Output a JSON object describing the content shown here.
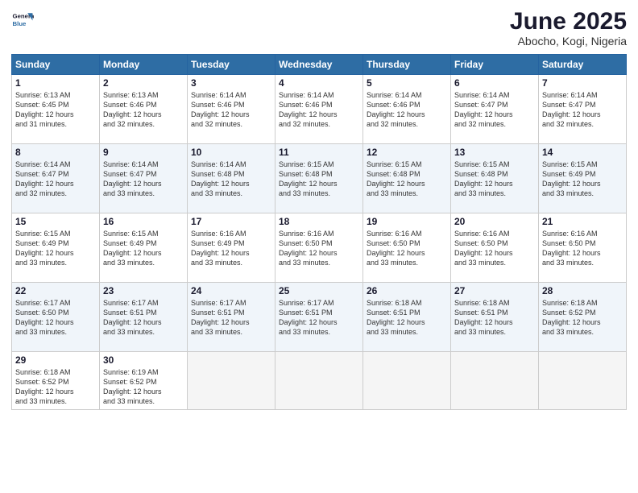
{
  "header": {
    "logo_line1": "General",
    "logo_line2": "Blue",
    "month_title": "June 2025",
    "location": "Abocho, Kogi, Nigeria"
  },
  "weekdays": [
    "Sunday",
    "Monday",
    "Tuesday",
    "Wednesday",
    "Thursday",
    "Friday",
    "Saturday"
  ],
  "weeks": [
    [
      {
        "day": "1",
        "rise": "6:13 AM",
        "set": "6:45 PM",
        "hours": "12 hours",
        "mins": "31 minutes"
      },
      {
        "day": "2",
        "rise": "6:13 AM",
        "set": "6:46 PM",
        "hours": "12 hours",
        "mins": "32 minutes"
      },
      {
        "day": "3",
        "rise": "6:14 AM",
        "set": "6:46 PM",
        "hours": "12 hours",
        "mins": "32 minutes"
      },
      {
        "day": "4",
        "rise": "6:14 AM",
        "set": "6:46 PM",
        "hours": "12 hours",
        "mins": "32 minutes"
      },
      {
        "day": "5",
        "rise": "6:14 AM",
        "set": "6:46 PM",
        "hours": "12 hours",
        "mins": "32 minutes"
      },
      {
        "day": "6",
        "rise": "6:14 AM",
        "set": "6:47 PM",
        "hours": "12 hours",
        "mins": "32 minutes"
      },
      {
        "day": "7",
        "rise": "6:14 AM",
        "set": "6:47 PM",
        "hours": "12 hours",
        "mins": "32 minutes"
      }
    ],
    [
      {
        "day": "8",
        "rise": "6:14 AM",
        "set": "6:47 PM",
        "hours": "12 hours",
        "mins": "32 minutes"
      },
      {
        "day": "9",
        "rise": "6:14 AM",
        "set": "6:47 PM",
        "hours": "12 hours",
        "mins": "33 minutes"
      },
      {
        "day": "10",
        "rise": "6:14 AM",
        "set": "6:48 PM",
        "hours": "12 hours",
        "mins": "33 minutes"
      },
      {
        "day": "11",
        "rise": "6:15 AM",
        "set": "6:48 PM",
        "hours": "12 hours",
        "mins": "33 minutes"
      },
      {
        "day": "12",
        "rise": "6:15 AM",
        "set": "6:48 PM",
        "hours": "12 hours",
        "mins": "33 minutes"
      },
      {
        "day": "13",
        "rise": "6:15 AM",
        "set": "6:48 PM",
        "hours": "12 hours",
        "mins": "33 minutes"
      },
      {
        "day": "14",
        "rise": "6:15 AM",
        "set": "6:49 PM",
        "hours": "12 hours",
        "mins": "33 minutes"
      }
    ],
    [
      {
        "day": "15",
        "rise": "6:15 AM",
        "set": "6:49 PM",
        "hours": "12 hours",
        "mins": "33 minutes"
      },
      {
        "day": "16",
        "rise": "6:15 AM",
        "set": "6:49 PM",
        "hours": "12 hours",
        "mins": "33 minutes"
      },
      {
        "day": "17",
        "rise": "6:16 AM",
        "set": "6:49 PM",
        "hours": "12 hours",
        "mins": "33 minutes"
      },
      {
        "day": "18",
        "rise": "6:16 AM",
        "set": "6:50 PM",
        "hours": "12 hours",
        "mins": "33 minutes"
      },
      {
        "day": "19",
        "rise": "6:16 AM",
        "set": "6:50 PM",
        "hours": "12 hours",
        "mins": "33 minutes"
      },
      {
        "day": "20",
        "rise": "6:16 AM",
        "set": "6:50 PM",
        "hours": "12 hours",
        "mins": "33 minutes"
      },
      {
        "day": "21",
        "rise": "6:16 AM",
        "set": "6:50 PM",
        "hours": "12 hours",
        "mins": "33 minutes"
      }
    ],
    [
      {
        "day": "22",
        "rise": "6:17 AM",
        "set": "6:50 PM",
        "hours": "12 hours",
        "mins": "33 minutes"
      },
      {
        "day": "23",
        "rise": "6:17 AM",
        "set": "6:51 PM",
        "hours": "12 hours",
        "mins": "33 minutes"
      },
      {
        "day": "24",
        "rise": "6:17 AM",
        "set": "6:51 PM",
        "hours": "12 hours",
        "mins": "33 minutes"
      },
      {
        "day": "25",
        "rise": "6:17 AM",
        "set": "6:51 PM",
        "hours": "12 hours",
        "mins": "33 minutes"
      },
      {
        "day": "26",
        "rise": "6:18 AM",
        "set": "6:51 PM",
        "hours": "12 hours",
        "mins": "33 minutes"
      },
      {
        "day": "27",
        "rise": "6:18 AM",
        "set": "6:51 PM",
        "hours": "12 hours",
        "mins": "33 minutes"
      },
      {
        "day": "28",
        "rise": "6:18 AM",
        "set": "6:52 PM",
        "hours": "12 hours",
        "mins": "33 minutes"
      }
    ],
    [
      {
        "day": "29",
        "rise": "6:18 AM",
        "set": "6:52 PM",
        "hours": "12 hours",
        "mins": "33 minutes"
      },
      {
        "day": "30",
        "rise": "6:19 AM",
        "set": "6:52 PM",
        "hours": "12 hours",
        "mins": "33 minutes"
      },
      null,
      null,
      null,
      null,
      null
    ]
  ],
  "labels": {
    "sunrise": "Sunrise:",
    "sunset": "Sunset:",
    "daylight": "Daylight:"
  }
}
